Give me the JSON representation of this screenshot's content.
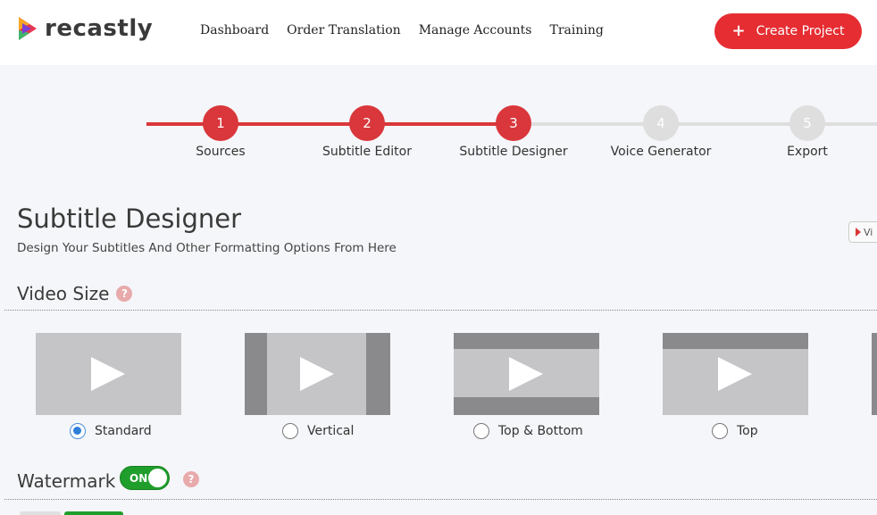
{
  "header": {
    "logo_text": "recastly",
    "nav": [
      "Dashboard",
      "Order Translation",
      "Manage Accounts",
      "Training"
    ],
    "create_button": "Create Project",
    "create_icon": "+"
  },
  "stepper": {
    "current_step": 3,
    "steps": [
      {
        "number": "1",
        "label": "Sources"
      },
      {
        "number": "2",
        "label": "Subtitle Editor"
      },
      {
        "number": "3",
        "label": "Subtitle Designer"
      },
      {
        "number": "4",
        "label": "Voice Generator"
      },
      {
        "number": "5",
        "label": "Export"
      }
    ]
  },
  "page": {
    "title": "Subtitle Designer",
    "subtitle": "Design Your Subtitles And Other Formatting Options From Here",
    "video_tab": "Vi"
  },
  "video_size": {
    "title": "Video Size",
    "help": "?",
    "options": [
      {
        "label": "Standard",
        "selected": true
      },
      {
        "label": "Vertical",
        "selected": false
      },
      {
        "label": "Top & Bottom",
        "selected": false
      },
      {
        "label": "Top",
        "selected": false
      }
    ]
  },
  "watermark": {
    "title": "Watermark",
    "toggle": "ON",
    "help": "?"
  },
  "colors": {
    "accent": "#e52d32",
    "step_done": "#d9373b",
    "toggle_on": "#1f9e2c"
  }
}
